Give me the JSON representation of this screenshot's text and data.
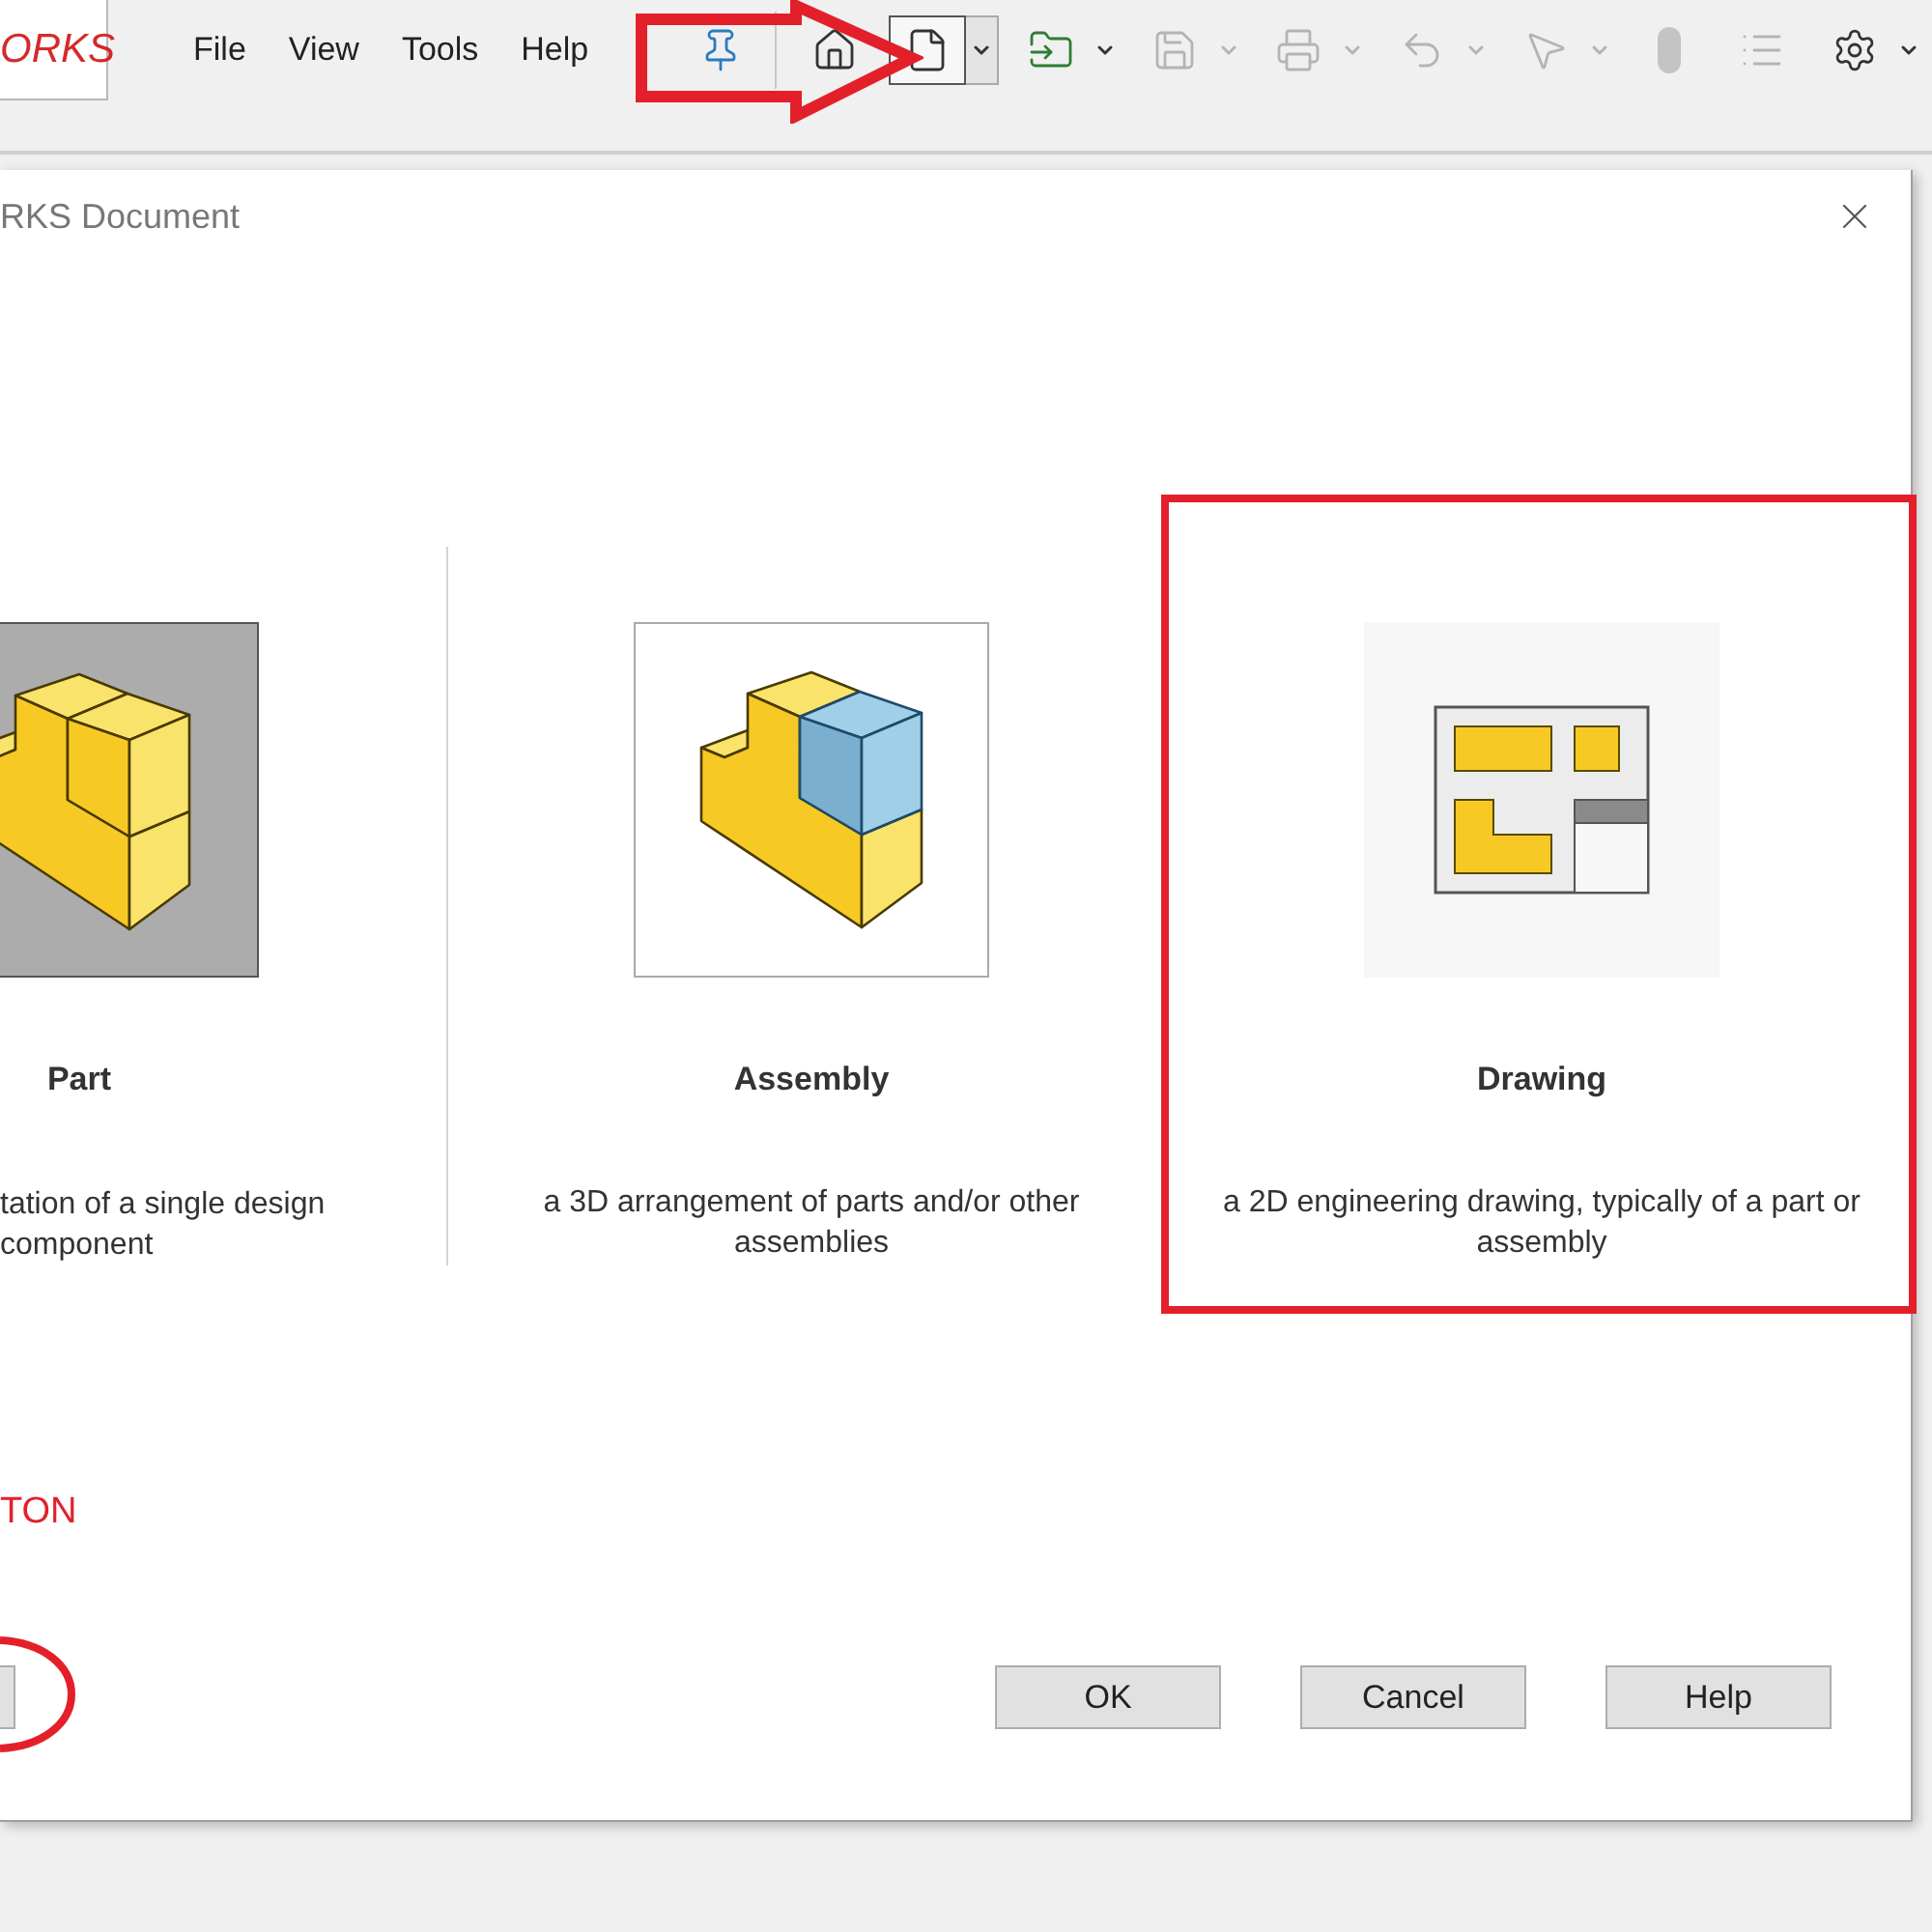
{
  "app": {
    "logo_text": "ORKS",
    "menu": [
      "File",
      "View",
      "Tools",
      "Help"
    ]
  },
  "toolbar": [
    {
      "kind": "pin",
      "disabled": false,
      "dropdown": false,
      "selected": false
    },
    {
      "kind": "home",
      "disabled": false,
      "dropdown": false,
      "selected": false
    },
    {
      "kind": "new",
      "disabled": false,
      "dropdown": true,
      "selected": true
    },
    {
      "kind": "open",
      "disabled": false,
      "dropdown": true,
      "selected": false
    },
    {
      "kind": "save",
      "disabled": true,
      "dropdown": true,
      "selected": false
    },
    {
      "kind": "print",
      "disabled": true,
      "dropdown": true,
      "selected": false
    },
    {
      "kind": "undo",
      "disabled": true,
      "dropdown": true,
      "selected": false
    },
    {
      "kind": "select",
      "disabled": true,
      "dropdown": true,
      "selected": false
    },
    {
      "kind": "toggle",
      "disabled": true,
      "dropdown": false,
      "selected": false
    },
    {
      "kind": "list",
      "disabled": true,
      "dropdown": false,
      "selected": false
    },
    {
      "kind": "settings",
      "disabled": false,
      "dropdown": true,
      "selected": false
    }
  ],
  "dialog": {
    "title": "RKS Document",
    "document_types": [
      {
        "kind": "part",
        "label": "Part",
        "description": "tation of a single design component",
        "selected": true
      },
      {
        "kind": "assembly",
        "label": "Assembly",
        "description": "a 3D arrangement of parts and/or other assemblies",
        "selected": false
      },
      {
        "kind": "drawing",
        "label": "Drawing",
        "description": "a 2D engineering drawing, typically of a part or assembly",
        "selected": false
      }
    ],
    "note": "TON",
    "buttons": [
      "OK",
      "Cancel",
      "Help"
    ]
  },
  "annotations": [
    {
      "kind": "arrow"
    },
    {
      "kind": "rectangle"
    },
    {
      "kind": "ellipse"
    }
  ]
}
